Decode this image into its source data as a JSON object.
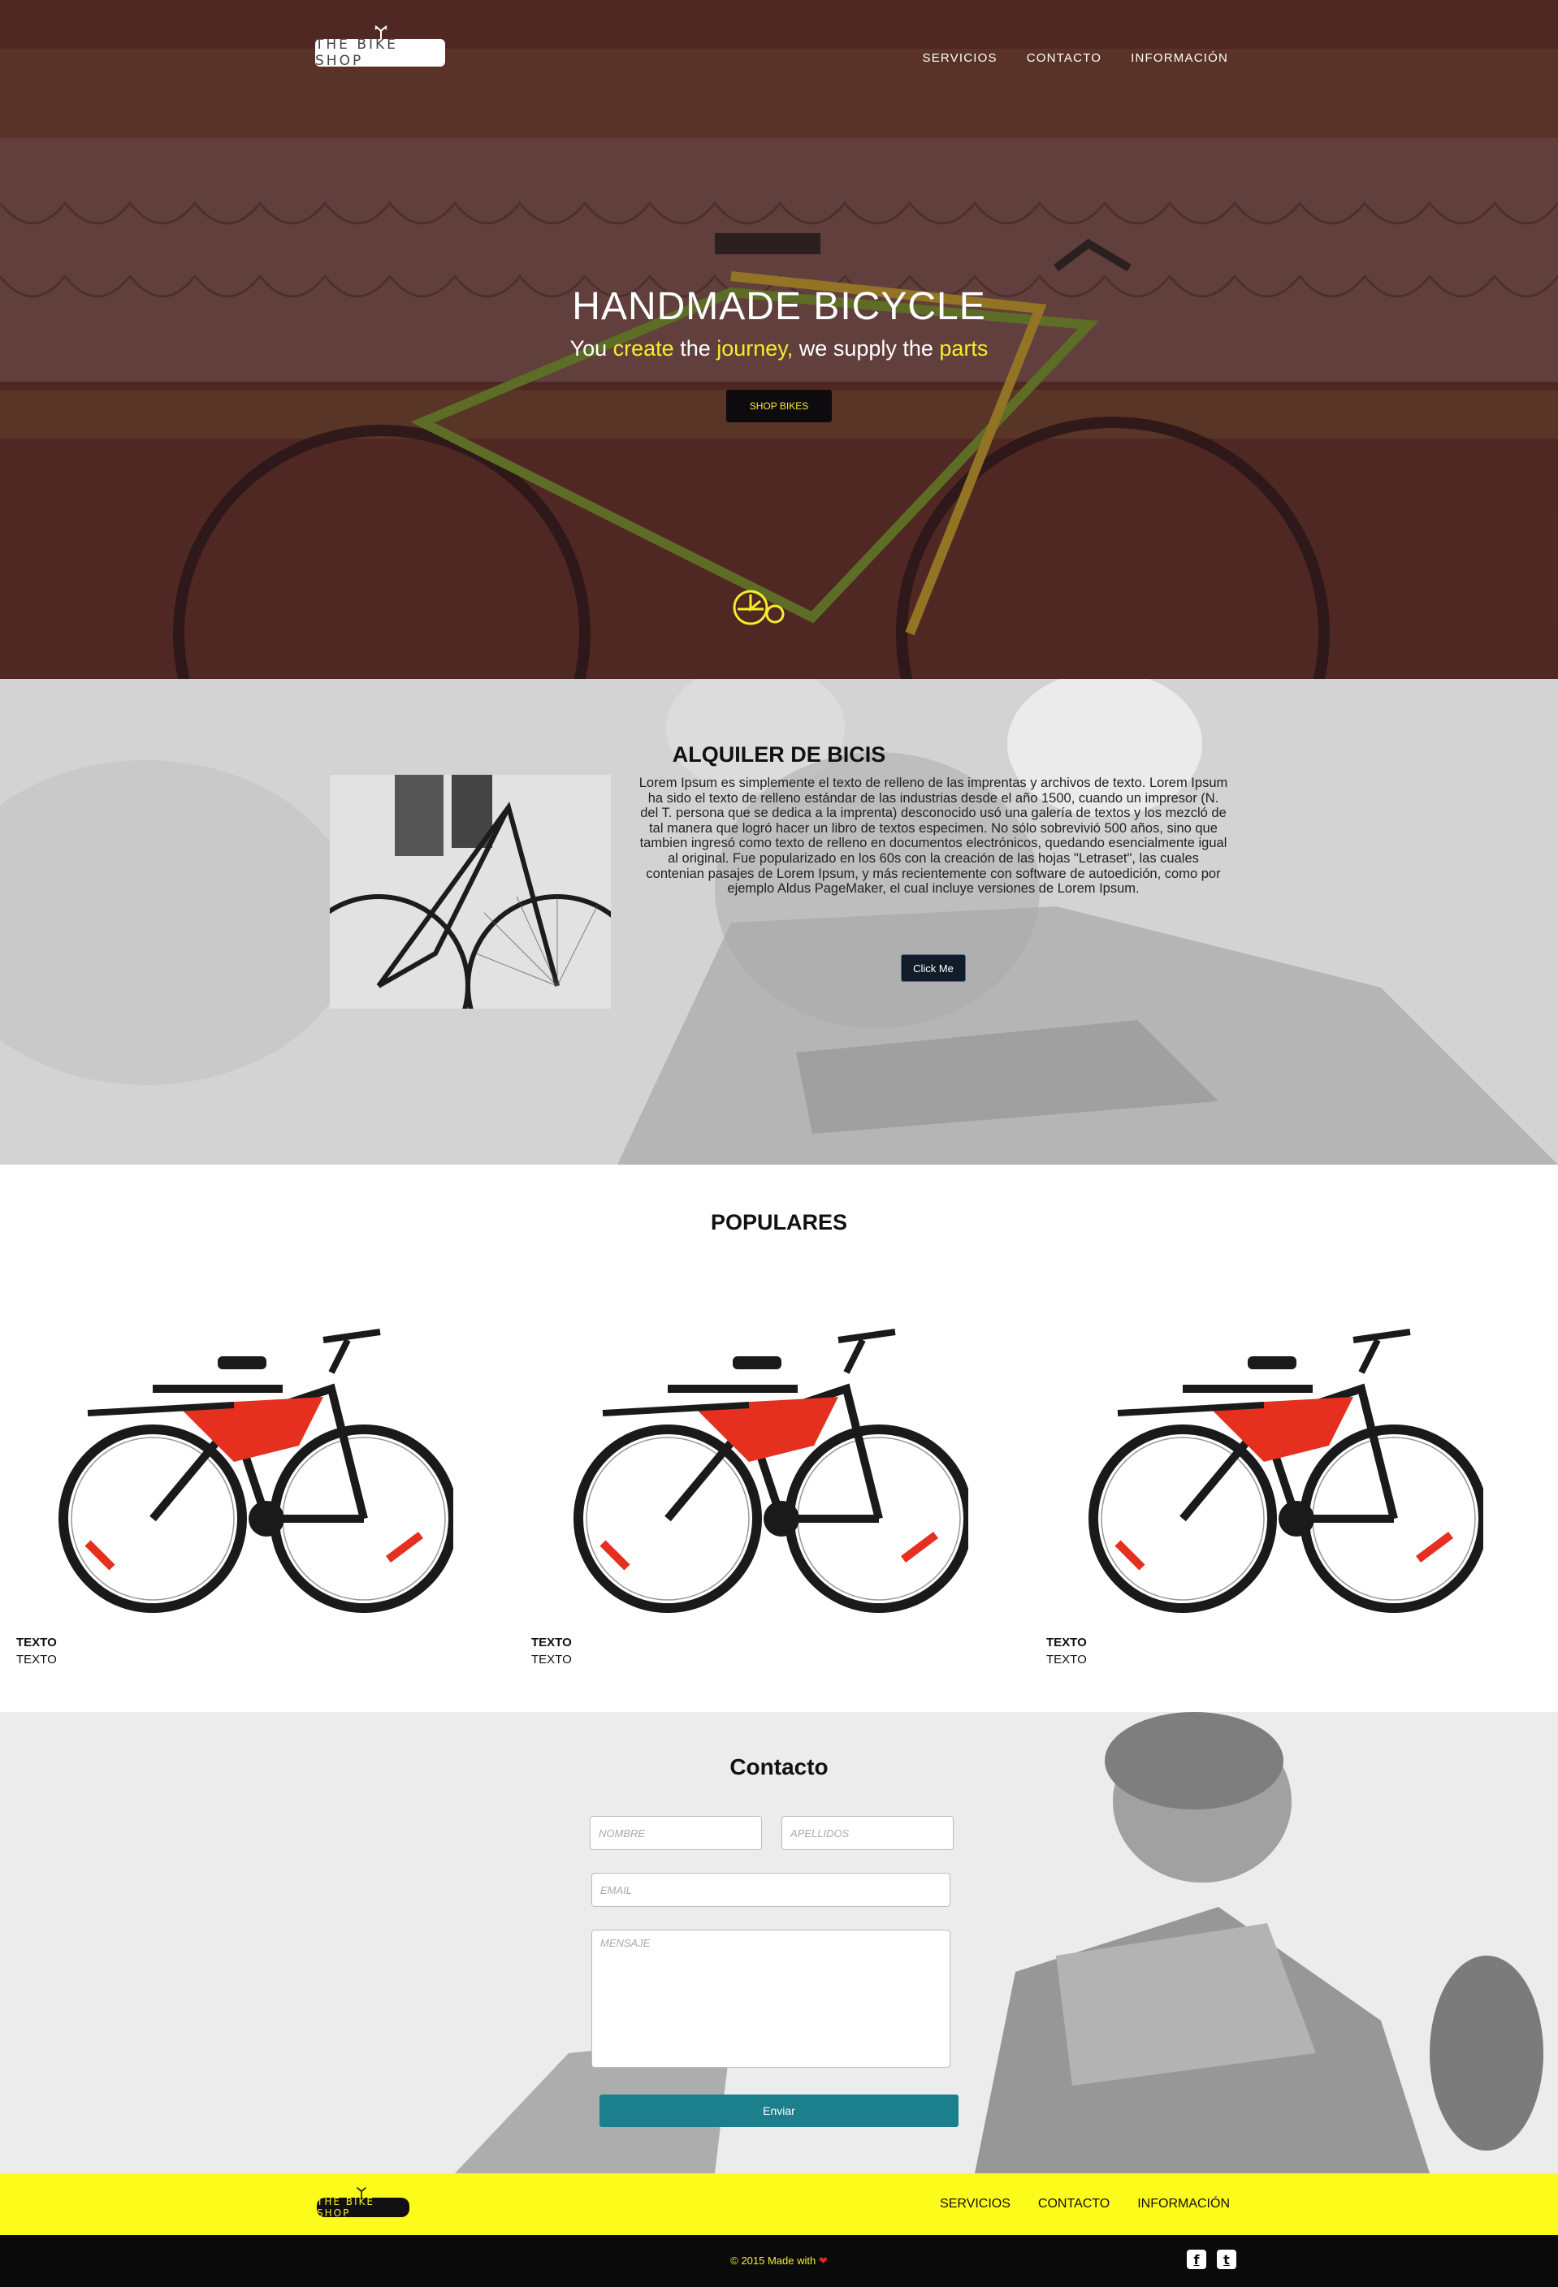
{
  "brand": {
    "name": "THE BIKE SHOP",
    "accent": "#f4ee2a",
    "button_teal": "#1b7f8c"
  },
  "nav": {
    "items": [
      "SERVICIOS",
      "CONTACTO",
      "INFORMACIÓN"
    ]
  },
  "hero": {
    "title": "HANDMADE BICYCLE",
    "subtitle_parts": [
      "You ",
      "create",
      " the ",
      "journey,",
      " we supply the ",
      "parts"
    ],
    "button": "SHOP BIKES",
    "icon": "bicycle-wheel-icon"
  },
  "rent": {
    "title": "ALQUILER DE BICIS",
    "text": "Lorem Ipsum es simplemente el texto de relleno de las imprentas y archivos de texto. Lorem Ipsum ha sido el texto de relleno estándar de las industrias desde el año 1500, cuando un impresor (N. del T. persona que se dedica a la imprenta) desconocido usó una galería de textos y los mezcló de tal manera que logró hacer un libro de textos especimen. No sólo sobrevivió 500 años, sino que tambien ingresó como texto de relleno en documentos electrónicos, quedando esencialmente igual al original. Fue popularizado en los 60s con la creación de las hojas \"Letraset\", las cuales contenian pasajes de Lorem Ipsum, y más recientemente con software de autoedición, como por ejemplo Aldus PageMaker, el cual incluye versiones de Lorem Ipsum.",
    "button": "Click Me"
  },
  "popular": {
    "title": "POPULARES",
    "products": [
      {
        "name": "TEXTO",
        "sub": "TEXTO"
      },
      {
        "name": "TEXTO",
        "sub": "TEXTO"
      },
      {
        "name": "TEXTO",
        "sub": "TEXTO"
      }
    ]
  },
  "contact": {
    "title": "Contacto",
    "name_placeholder": "NOMBRE",
    "surname_placeholder": "APELLIDOS",
    "email_placeholder": "EMAIL",
    "message_placeholder": "MENSAJE",
    "button": "Enviar"
  },
  "footer": {
    "nav": [
      "SERVICIOS",
      "CONTACTO",
      "INFORMACIÓN"
    ],
    "copyright_prefix": "© 2015 Made with ",
    "heart": "❤",
    "social": [
      {
        "icon": "facebook-icon",
        "glyph": "f"
      },
      {
        "icon": "twitter-icon",
        "glyph": "t"
      }
    ]
  }
}
